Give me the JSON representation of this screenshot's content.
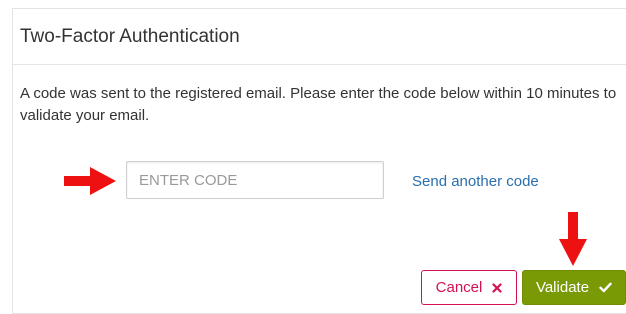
{
  "modal": {
    "title": "Two-Factor Authentication",
    "message": "A code was sent to the registered email. Please enter the code below within 10 minutes to validate your email."
  },
  "code_field": {
    "placeholder": "ENTER CODE",
    "value": ""
  },
  "resend_link": {
    "label": "Send another code"
  },
  "buttons": {
    "cancel_label": "Cancel",
    "validate_label": "Validate"
  },
  "icons": {
    "cancel": "close-icon",
    "validate": "checkmark-icon",
    "annotation": "red-arrow-icon"
  },
  "colors": {
    "link": "#2a6ead",
    "cancel": "#d3114f",
    "validate": "#7a9a05",
    "annotation_arrow": "#ee1111"
  }
}
